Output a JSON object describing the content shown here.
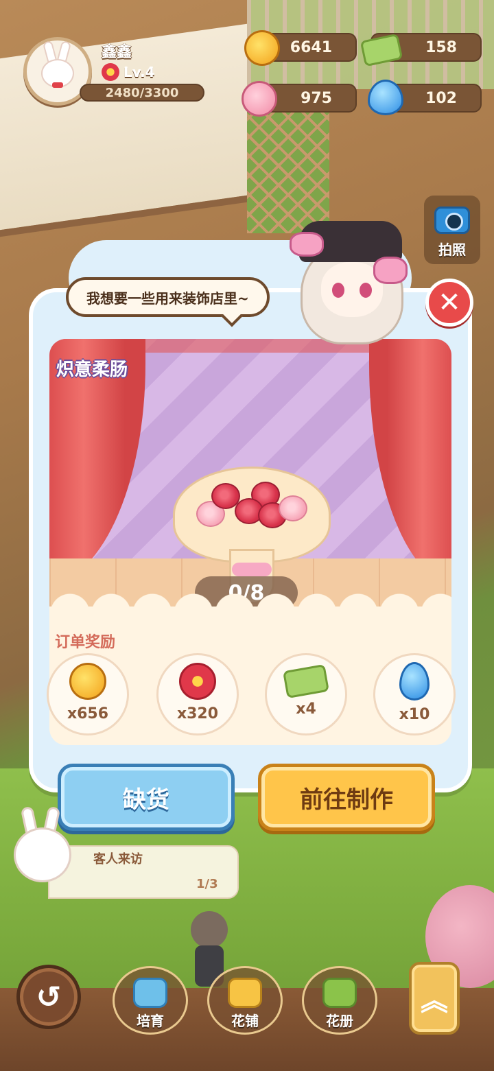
{
  "player": {
    "name": "鑫鑫",
    "level": "Lv.4",
    "xp": "2480/3300"
  },
  "resources": {
    "leaves": "6641",
    "tickets": "158",
    "hearts": "975",
    "water": "102"
  },
  "camera": {
    "label": "拍照"
  },
  "order": {
    "speech": "我想要一些用来装饰店里~",
    "item_name": "炽意柔肠",
    "progress": "0/8",
    "reward_title": "订单奖励",
    "rewards": [
      {
        "icon": "leaf-icon",
        "qty": "x656"
      },
      {
        "icon": "flower-icon",
        "qty": "x320"
      },
      {
        "icon": "ticket-icon",
        "qty": "x4"
      },
      {
        "icon": "water-drop-icon",
        "qty": "x10"
      }
    ],
    "out_of_stock_label": "缺货",
    "go_make_label": "前往制作"
  },
  "task": {
    "title": "客人来访",
    "progress": "1/3"
  },
  "nav": {
    "cultivate": "培育",
    "flower_shop": "花铺",
    "album": "花册"
  },
  "colors": {
    "close": "#e84a4a",
    "out_of_stock_button": "#8ecff2",
    "go_make_button": "#ffc54a",
    "dialog_bg": "#dff0fb"
  }
}
